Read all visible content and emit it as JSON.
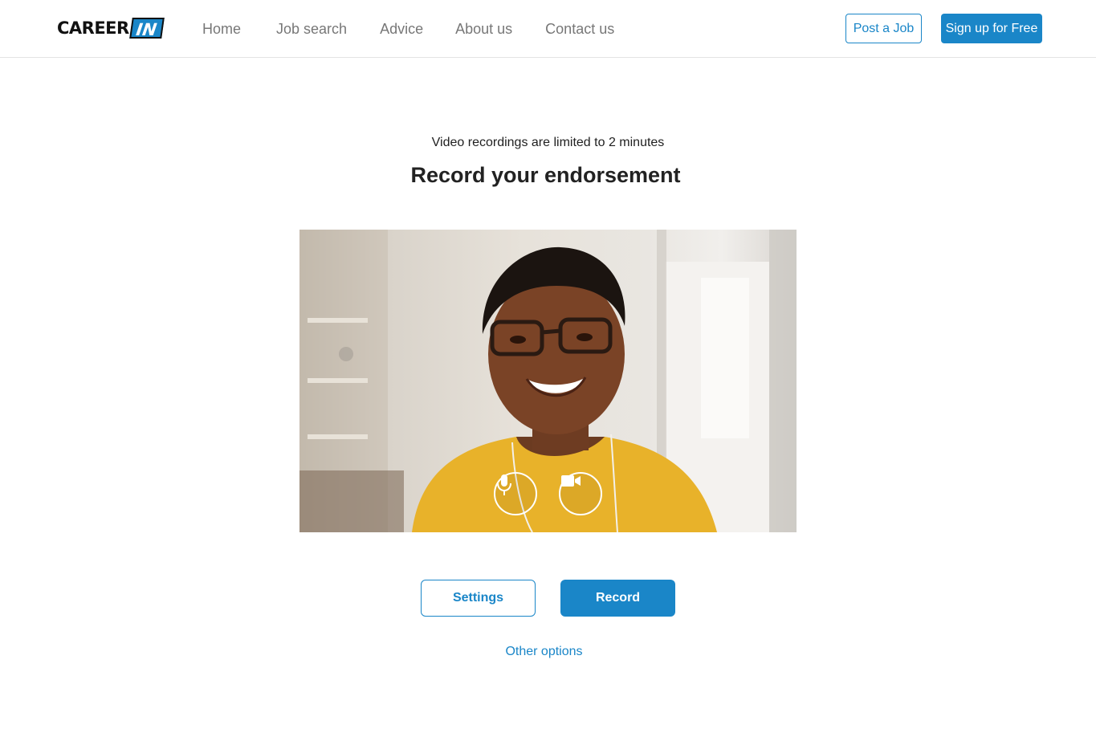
{
  "header": {
    "logo": {
      "word": "CAREER",
      "box": "IN"
    },
    "nav": [
      "Home",
      "Job search",
      "Advice",
      "About us",
      "Contact us"
    ],
    "post_job_label": "Post a Job",
    "signup_label": "Sign up for Free"
  },
  "main": {
    "subtitle": "Video recordings are limited to 2 minutes",
    "title": "Record your endorsement",
    "video_controls": {
      "mic_icon": "microphone-icon",
      "camera_icon": "video-camera-icon"
    },
    "settings_label": "Settings",
    "record_label": "Record",
    "other_options_label": "Other options"
  },
  "colors": {
    "accent": "#1a86c8",
    "nav_text": "#777777",
    "heading": "#222222"
  }
}
